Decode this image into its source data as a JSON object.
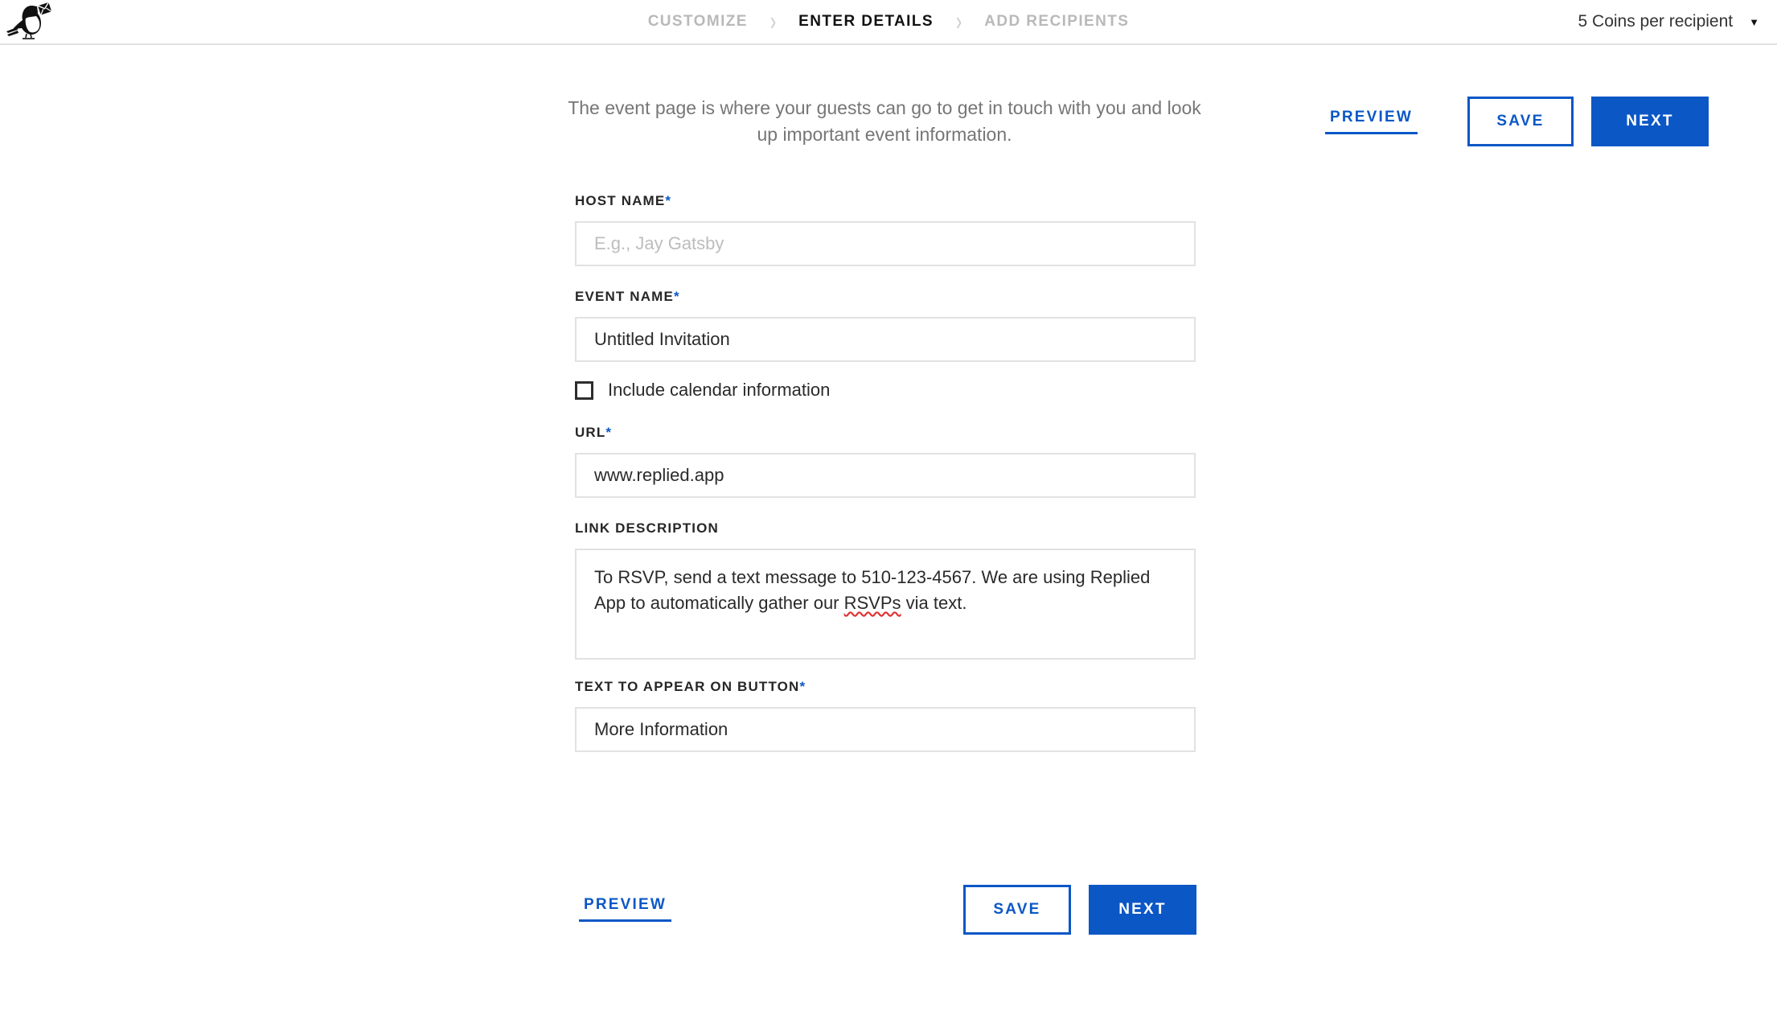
{
  "header": {
    "logo_icon": "carrier-pigeon-logo",
    "breadcrumb": {
      "steps": [
        {
          "label": "CUSTOMIZE",
          "state": "inactive"
        },
        {
          "label": "ENTER DETAILS",
          "state": "active"
        },
        {
          "label": "ADD RECIPIENTS",
          "state": "inactive"
        }
      ],
      "separator": "›"
    },
    "coins": {
      "label": "5 Coins per recipient",
      "caret_icon": "chevron-down-icon",
      "caret_glyph": "▼"
    }
  },
  "intro": {
    "text": "The event page is where your guests can go to get in touch with you and look up important event information."
  },
  "actions": {
    "preview_label": "PREVIEW",
    "save_label": "SAVE",
    "next_label": "NEXT",
    "accent_color": "#0b57c6"
  },
  "form": {
    "host_name": {
      "label": "HOST NAME",
      "required_marker": "*",
      "value": "",
      "placeholder": "E.g., Jay Gatsby"
    },
    "event_name": {
      "label": "EVENT NAME",
      "required_marker": "*",
      "value": "Untitled Invitation",
      "placeholder": ""
    },
    "include_calendar": {
      "label": "Include calendar information",
      "checked": false
    },
    "url": {
      "label": "URL",
      "required_marker": "*",
      "value": "www.replied.app",
      "placeholder": ""
    },
    "link_description": {
      "label": "LINK DESCRIPTION",
      "required_marker": "",
      "text_before": "To RSVP, send a text message to 510-123-4567. We are using Replied App to automatically gather our ",
      "misspelled_word": "RSVPs",
      "text_after": " via text.",
      "full_value": "To RSVP, send a text message to 510-123-4567. We are using Replied App to automatically gather our RSVPs via text."
    },
    "button_text": {
      "label": "TEXT TO APPEAR ON BUTTON",
      "required_marker": "*",
      "value": "More Information",
      "placeholder": ""
    }
  }
}
